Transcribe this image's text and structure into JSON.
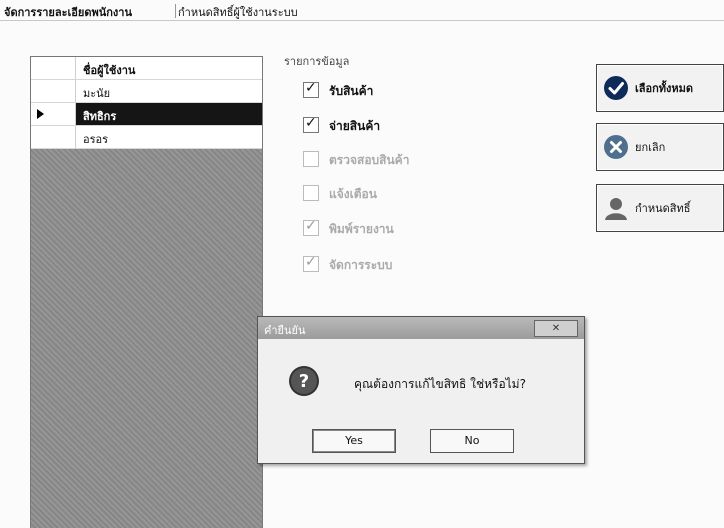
{
  "tabs": [
    {
      "label": "จัดการรายละเอียดพนักงาน"
    },
    {
      "label": "กำหนดสิทธิ์ผู้ใช้งานระบบ"
    }
  ],
  "grid": {
    "header": "ชื่อผู้ใช้งาน",
    "rows": [
      "มะนัย",
      "สิทธิกร",
      "อรอร"
    ],
    "selected_row": 1
  },
  "permissions": {
    "title": "รายการข้อมูล",
    "items": [
      {
        "label": "รับสินค้า",
        "checked": true,
        "enabled": true
      },
      {
        "label": "จ่ายสินค้า",
        "checked": true,
        "enabled": true
      },
      {
        "label": "ตรวจสอบสินค้า",
        "checked": false,
        "enabled": false
      },
      {
        "label": "แจ้งเตือน",
        "checked": false,
        "enabled": false
      },
      {
        "label": "พิมพ์รายงาน",
        "checked": true,
        "enabled": false
      },
      {
        "label": "จัดการระบบ",
        "checked": true,
        "enabled": false
      }
    ]
  },
  "buttons": {
    "select_all": "เลือกทั้งหมด",
    "cancel": "ยกเลิก",
    "set_permission": "กำหนดสิทธิ์"
  },
  "dialog": {
    "title": "คำยืนยัน",
    "message": "คุณต้องการแก้ไขสิทธิ ใช่หรือไม่?",
    "yes": "Yes",
    "no": "No",
    "close": "✕"
  },
  "colors": {
    "accent": "#151515",
    "check_icon": "#0f2a5a",
    "cancel_icon": "#4f6f8f"
  }
}
